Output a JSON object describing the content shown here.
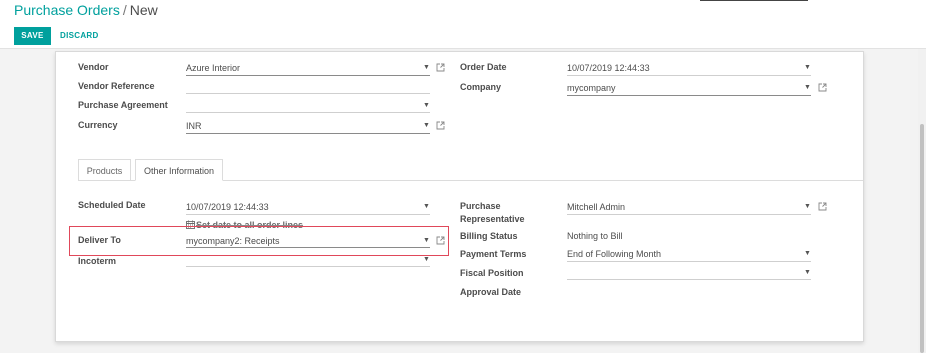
{
  "breadcrumb": {
    "parent": "Purchase Orders",
    "separator": "/",
    "current": "New"
  },
  "toolbar": {
    "save_label": "SAVE",
    "discard_label": "DISCARD"
  },
  "header_fields": {
    "vendor": {
      "label": "Vendor",
      "value": "Azure Interior"
    },
    "vendor_reference": {
      "label": "Vendor Reference",
      "value": ""
    },
    "purchase_agreement": {
      "label": "Purchase Agreement",
      "value": ""
    },
    "currency": {
      "label": "Currency",
      "value": "INR"
    },
    "order_date": {
      "label": "Order Date",
      "value": "10/07/2019 12:44:33"
    },
    "company": {
      "label": "Company",
      "value": "mycompany"
    }
  },
  "tabs": [
    {
      "label": "Products",
      "active": false
    },
    {
      "label": "Other Information",
      "active": true
    }
  ],
  "other_info": {
    "scheduled_date": {
      "label": "Scheduled Date",
      "value": "10/07/2019 12:44:33"
    },
    "set_date_link": "Set date to all order lines",
    "deliver_to": {
      "label": "Deliver To",
      "value": "mycompany2: Receipts"
    },
    "incoterm": {
      "label": "Incoterm",
      "value": ""
    },
    "purchase_representative": {
      "label_line1": "Purchase",
      "label_line2": "Representative",
      "value": "Mitchell Admin"
    },
    "billing_status": {
      "label": "Billing Status",
      "value": "Nothing to Bill"
    },
    "payment_terms": {
      "label": "Payment Terms",
      "value": "End of Following Month"
    },
    "fiscal_position": {
      "label": "Fiscal Position",
      "value": ""
    },
    "approval_date": {
      "label": "Approval Date",
      "value": ""
    }
  },
  "icons": {
    "dropdown": "caret-down-icon",
    "external": "external-link-icon",
    "calendar": "calendar-icon"
  },
  "colors": {
    "accent": "#00a09d",
    "highlight_border": "#e0485a"
  }
}
